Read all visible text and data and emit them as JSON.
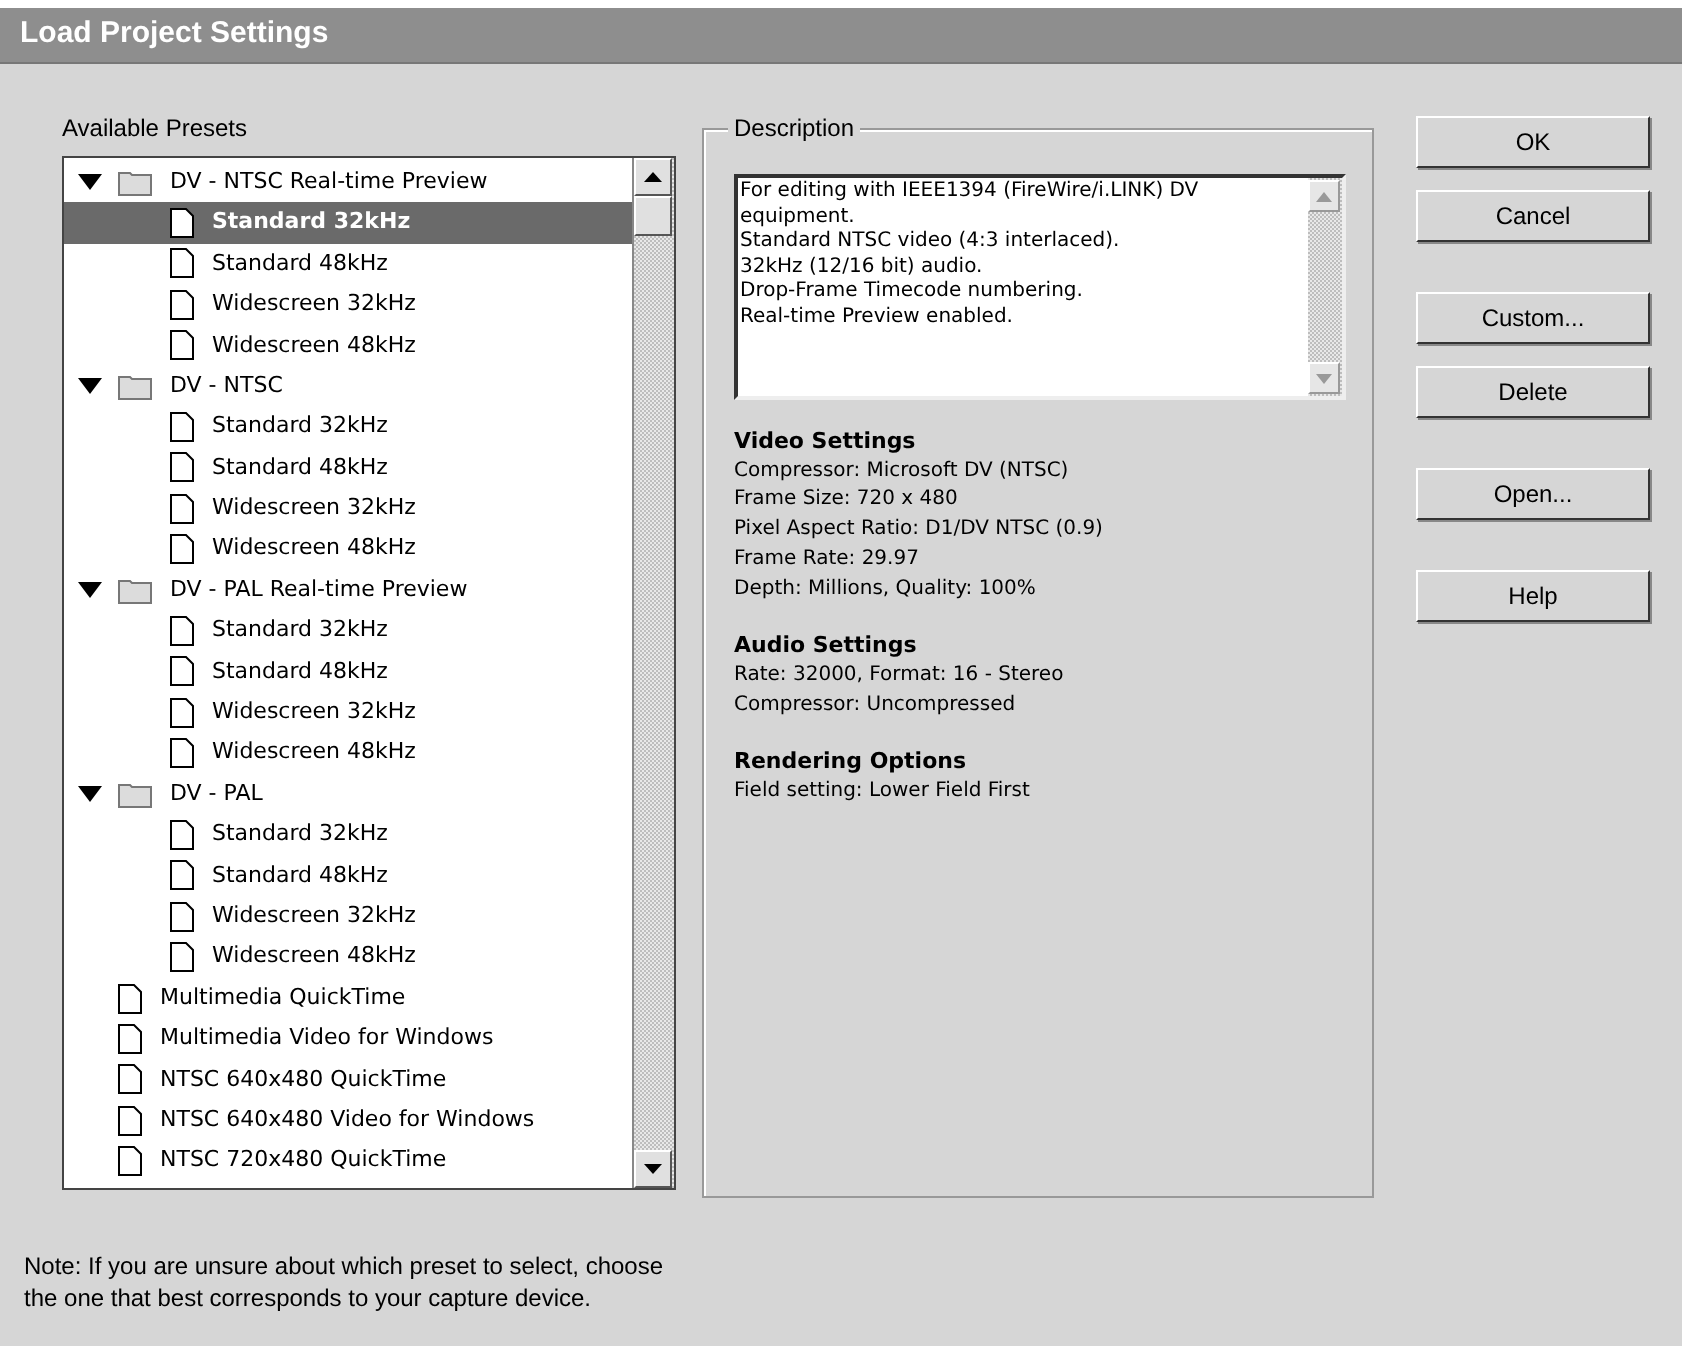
{
  "window": {
    "title": "Load Project Settings"
  },
  "presets_label": "Available Presets",
  "presets": [
    {
      "kind": "folder",
      "label": "DV - NTSC Real-time Preview",
      "expanded": true,
      "selected": false,
      "children": [
        {
          "kind": "file",
          "label": "Standard 32kHz",
          "selected": true
        },
        {
          "kind": "file",
          "label": "Standard 48kHz",
          "selected": false
        },
        {
          "kind": "file",
          "label": "Widescreen 32kHz",
          "selected": false
        },
        {
          "kind": "file",
          "label": "Widescreen 48kHz",
          "selected": false
        }
      ]
    },
    {
      "kind": "folder",
      "label": "DV - NTSC",
      "expanded": true,
      "selected": false,
      "children": [
        {
          "kind": "file",
          "label": "Standard 32kHz",
          "selected": false
        },
        {
          "kind": "file",
          "label": "Standard 48kHz",
          "selected": false
        },
        {
          "kind": "file",
          "label": "Widescreen 32kHz",
          "selected": false
        },
        {
          "kind": "file",
          "label": "Widescreen 48kHz",
          "selected": false
        }
      ]
    },
    {
      "kind": "folder",
      "label": "DV - PAL Real-time Preview",
      "expanded": true,
      "selected": false,
      "children": [
        {
          "kind": "file",
          "label": "Standard 32kHz",
          "selected": false
        },
        {
          "kind": "file",
          "label": "Standard 48kHz",
          "selected": false
        },
        {
          "kind": "file",
          "label": "Widescreen 32kHz",
          "selected": false
        },
        {
          "kind": "file",
          "label": "Widescreen 48kHz",
          "selected": false
        }
      ]
    },
    {
      "kind": "folder",
      "label": "DV - PAL",
      "expanded": true,
      "selected": false,
      "children": [
        {
          "kind": "file",
          "label": "Standard 32kHz",
          "selected": false
        },
        {
          "kind": "file",
          "label": "Standard 48kHz",
          "selected": false
        },
        {
          "kind": "file",
          "label": "Widescreen 32kHz",
          "selected": false
        },
        {
          "kind": "file",
          "label": "Widescreen 48kHz",
          "selected": false
        }
      ]
    },
    {
      "kind": "file",
      "label": "Multimedia QuickTime",
      "selected": false
    },
    {
      "kind": "file",
      "label": "Multimedia Video for Windows",
      "selected": false
    },
    {
      "kind": "file",
      "label": "NTSC 640x480 QuickTime",
      "selected": false
    },
    {
      "kind": "file",
      "label": "NTSC 640x480 Video for Windows",
      "selected": false
    },
    {
      "kind": "file",
      "label": "NTSC 720x480 QuickTime",
      "selected": false
    }
  ],
  "description": {
    "legend": "Description",
    "text": [
      "For editing with IEEE1394 (FireWire/i.LINK) DV equipment.",
      "Standard NTSC video (4:3 interlaced).",
      "32kHz (12/16 bit) audio.",
      "Drop-Frame Timecode numbering.",
      "Real-time Preview enabled."
    ],
    "sections": [
      {
        "heading": "Video Settings",
        "lines": [
          "Compressor: Microsoft DV (NTSC)",
          "Frame Size: 720 x 480",
          "Pixel Aspect Ratio: D1/DV NTSC (0.9)",
          "Frame Rate: 29.97",
          "Depth: Millions, Quality: 100%"
        ]
      },
      {
        "heading": "Audio Settings",
        "lines": [
          "Rate: 32000, Format: 16 - Stereo",
          "Compressor: Uncompressed"
        ]
      },
      {
        "heading": "Rendering Options",
        "lines": [
          "Field setting: Lower Field First"
        ]
      }
    ]
  },
  "button_groups": [
    [
      "OK",
      "Cancel"
    ],
    [
      "Custom...",
      "Delete"
    ],
    [
      "Open..."
    ],
    [
      "Help"
    ]
  ],
  "note": [
    "Note: If you are unsure about which preset to select, choose",
    "the one that best corresponds to your capture device."
  ]
}
